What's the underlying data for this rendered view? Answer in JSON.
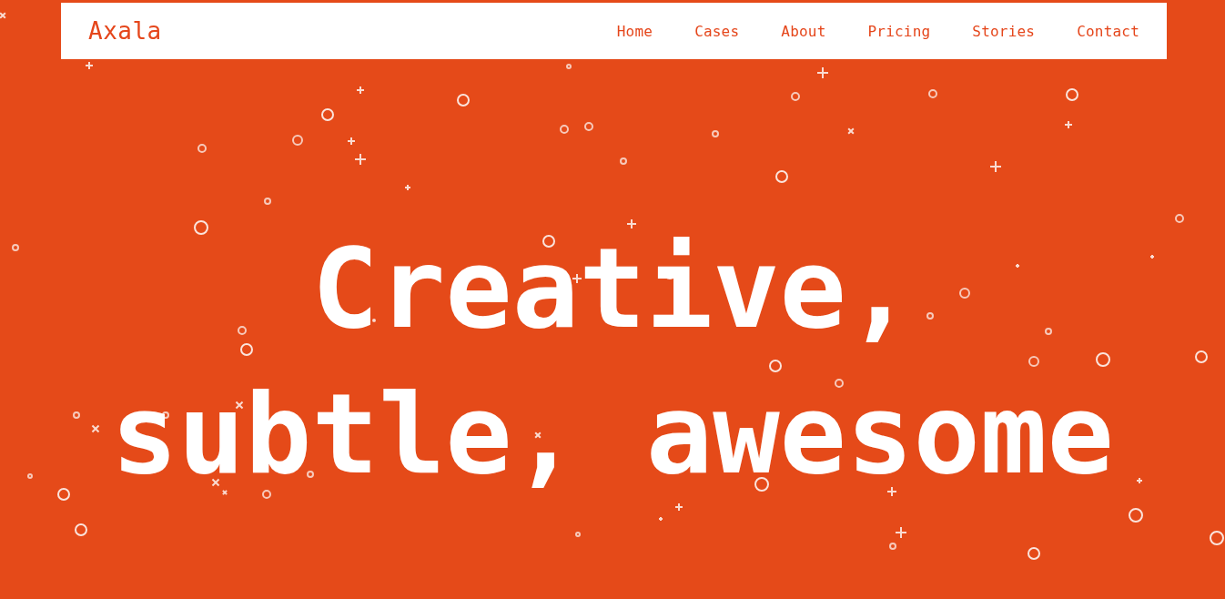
{
  "header": {
    "logo": "Axala",
    "nav": [
      {
        "label": "Home"
      },
      {
        "label": "Cases"
      },
      {
        "label": "About"
      },
      {
        "label": "Pricing"
      },
      {
        "label": "Stories"
      },
      {
        "label": "Contact"
      }
    ]
  },
  "hero": {
    "headline_lines": [
      "Creative,",
      "subtle, awesome"
    ]
  }
}
